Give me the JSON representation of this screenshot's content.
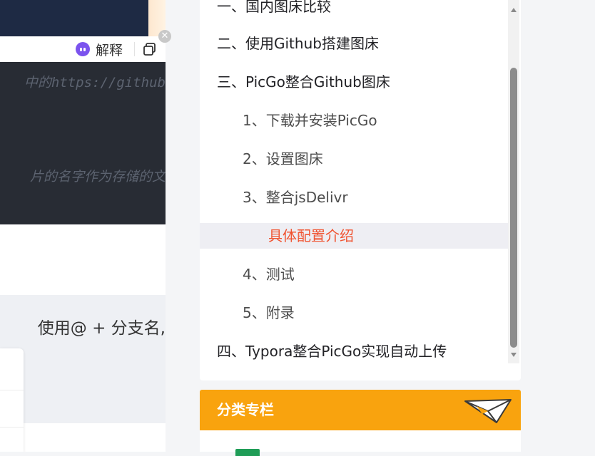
{
  "article": {
    "popup": {
      "explain_label": "解释"
    },
    "code_lines": [
      "中的https://github",
      "片的名字作为存储的文"
    ],
    "quote_text": "使用@ + 分支名,"
  },
  "toc": {
    "items": [
      {
        "label": "一、国内图床比较",
        "level": 1,
        "active": false
      },
      {
        "label": "二、使用Github搭建图床",
        "level": 1,
        "active": false
      },
      {
        "label": "三、PicGo整合Github图床",
        "level": 1,
        "active": false
      },
      {
        "label": "1、下载并安装PicGo",
        "level": 2,
        "active": false
      },
      {
        "label": "2、设置图床",
        "level": 2,
        "active": false
      },
      {
        "label": "3、整合jsDelivr",
        "level": 2,
        "active": false
      },
      {
        "label": "具体配置介绍",
        "level": 3,
        "active": true
      },
      {
        "label": "4、测试",
        "level": 2,
        "active": false
      },
      {
        "label": "5、附录",
        "level": 2,
        "active": false
      },
      {
        "label": "四、Typora整合PicGo实现自动上传",
        "level": 1,
        "active": false
      }
    ]
  },
  "category": {
    "title": "分类专栏"
  },
  "colors": {
    "accent": "#f0522f",
    "category_header": "#f9a30e",
    "code_bg": "#282c34",
    "ai_icon": "#7b53ee"
  }
}
